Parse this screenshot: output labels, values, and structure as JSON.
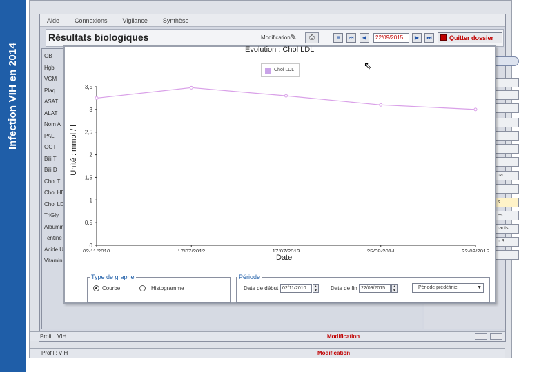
{
  "sidebar_band": {
    "text": "Infection VIH en 2014"
  },
  "menubar": {
    "items": [
      "Aide",
      "Connexions",
      "Vigilance",
      "Synthèse"
    ]
  },
  "header": {
    "title": "Résultats biologiques",
    "modification_label": "Modification",
    "date": "22/09/2015",
    "quit_label": "Quitter dossier"
  },
  "lab_list": [
    "GB",
    "Hgb",
    "VGM",
    "Plaq",
    "ASAT",
    "ALAT",
    "Nom A",
    "PAL",
    "GGT",
    "Bili T",
    "Bili D",
    "Chol T",
    "Chol HD",
    "Chol LD",
    "TriGly",
    "Albumin",
    "Tentine",
    "Acide U",
    "Vitamin"
  ],
  "right_buttons": [
    "ie",
    "ua",
    "s",
    "es",
    "rants",
    "n 3"
  ],
  "status_rows": [
    {
      "left": "Profil : VIH",
      "right": "Modification"
    },
    {
      "left": "Profil : VIH",
      "right": "Modification"
    }
  ],
  "evo_window": {
    "title": "Evolution : Chol LDL",
    "legend": "Chol LDL",
    "xlabel": "Date",
    "ylabel": "Unité : mmol / l"
  },
  "chart_data": {
    "type": "line",
    "title": "Evolution : Chol LDL",
    "xlabel": "Date",
    "ylabel": "Unité : mmol / l",
    "x": [
      "02/11/2010",
      "17/07/2012",
      "17/07/2013",
      "25/08/2014",
      "22/09/2015"
    ],
    "series": [
      {
        "name": "Chol LDL",
        "values": [
          3.25,
          3.48,
          3.3,
          3.1,
          3.0
        ],
        "color": "#d9a0e8"
      }
    ],
    "ylim": [
      0,
      3.5
    ],
    "yticks": [
      "0",
      "0,5",
      "1",
      "1,5",
      "2",
      "2,5",
      "3",
      "3,5"
    ],
    "grid": false,
    "legend_position": "top-center"
  },
  "graph_type": {
    "title": "Type de graphe",
    "options": [
      {
        "label": "Courbe",
        "selected": true
      },
      {
        "label": "Histogramme",
        "selected": false
      }
    ]
  },
  "period": {
    "title": "Période",
    "start_label": "Date de début",
    "start_value": "02/11/2010",
    "end_label": "Date de fin",
    "end_value": "22/09/2015",
    "preset": "Période prédéfinie"
  }
}
